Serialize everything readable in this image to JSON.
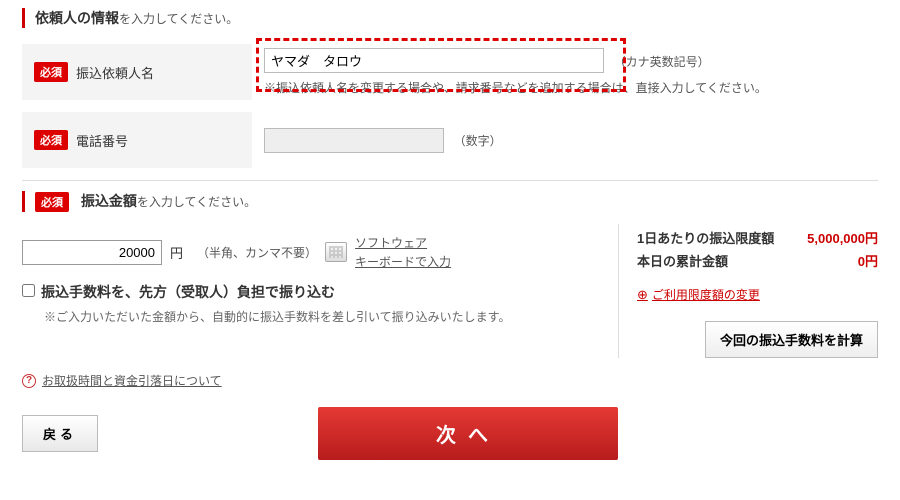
{
  "labels": {
    "required": "必須"
  },
  "client": {
    "header_main": "依頼人の情報",
    "header_sub": "を入力してください。",
    "name_label": "振込依頼人名",
    "name_value": "ヤマダ　タロウ",
    "name_note": "（カナ英数記号）",
    "name_hint": "※振込依頼人名を変更する場合や、請求番号などを追加する場合は、直接入力してください。",
    "phone_label": "電話番号",
    "phone_value": "",
    "phone_note": "（数字）"
  },
  "amount": {
    "header_main": "振込金額",
    "header_sub": "を入力してください。",
    "value": "20000",
    "unit": "円",
    "input_note": "（半角、カンマ不要）",
    "soft_kbd_line1": "ソフトウェア",
    "soft_kbd_line2": "キーボードで入力",
    "fee_checkbox_label": "振込手数料を、先方（受取人）負担で振り込む",
    "fee_note": "※ご入力いただいた金額から、自動的に振込手数料を差し引いて振り込みいたします。"
  },
  "limits": {
    "daily_label": "1日あたりの振込限度額",
    "daily_value": "5,000,000円",
    "today_label": "本日の累計金額",
    "today_value": "0円",
    "change_link": "ご利用限度額の変更",
    "calc_button": "今回の振込手数料を計算"
  },
  "help": {
    "handling_link": "お取扱時間と資金引落日について"
  },
  "nav": {
    "back": "戻る",
    "next": "次へ"
  }
}
